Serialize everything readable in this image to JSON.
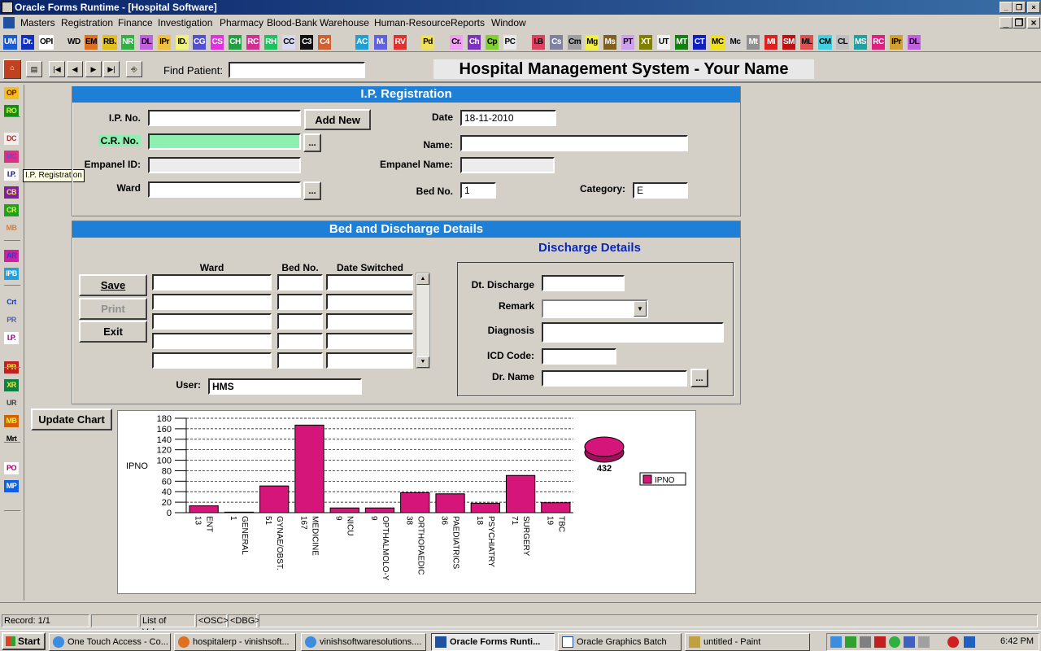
{
  "window": {
    "title": "Oracle Forms Runtime - [Hospital Software]"
  },
  "menu": [
    "Masters",
    "Registration",
    "Finance",
    "Investigation",
    "Pharmacy",
    "Blood-Bank",
    "Warehouse",
    "Human-Resource",
    "Reports",
    "Window"
  ],
  "toolbar_icons": [
    "UM",
    "Dr.",
    "OPI",
    "WD",
    "EM",
    "RB.",
    "NR",
    "DL",
    "IPr",
    "ID.",
    "CG",
    "CS",
    "CH",
    "RC",
    "RH",
    "CC",
    "C3",
    "C4",
    "AC",
    "M.",
    "RV",
    "Pd",
    "Cr.",
    "Ch",
    "Cp",
    "PC",
    "I.B",
    "Cs",
    "Cm",
    "Mg",
    "Ms",
    "PT",
    "XT",
    "UT",
    "MT",
    "CT",
    "MC",
    "Mc",
    "Mt",
    "MI",
    "SM",
    "ML",
    "CM",
    "CL",
    "MS",
    "RC",
    "IPr",
    "DL"
  ],
  "nav": {
    "find_patient_label": "Find Patient:",
    "find_patient_value": "",
    "header_title": "Hospital Management System - Your Name"
  },
  "sidebar": [
    "OP",
    "RO",
    "DC",
    "MC",
    "I.P.",
    "CB",
    "CR",
    "MB",
    "AR",
    "IPB",
    "Crt",
    "PR",
    "I.P.",
    "PR",
    "XR",
    "UR",
    "MB",
    "Mrt",
    "PO",
    "MP"
  ],
  "tooltip": "I.P. Registration",
  "ip_registration": {
    "title": "I.P. Registration",
    "ip_no_label": "I.P. No.",
    "ip_no": "",
    "add_new": "Add New",
    "date_label": "Date",
    "date": "18-11-2010",
    "cr_no_label": "C.R. No.",
    "cr_no": "",
    "lov_button": "...",
    "name_label": "Name:",
    "name": "",
    "empanel_id_label": "Empanel ID:",
    "empanel_id": "",
    "empanel_name_label": "Empanel Name:",
    "empanel_name": "",
    "ward_label": "Ward",
    "ward": "",
    "bed_no_label": "Bed No.",
    "bed_no": "1",
    "category_label": "Category:",
    "category": "E"
  },
  "bed_discharge": {
    "title": "Bed and Discharge Details",
    "col_ward": "Ward",
    "col_bed": "Bed No.",
    "col_date": "Date Switched",
    "save": "Save",
    "print": "Print",
    "exit": "Exit",
    "user_label": "User:",
    "user": "HMS"
  },
  "discharge": {
    "title": "Discharge Details",
    "dt_discharge_label": "Dt. Discharge",
    "dt_discharge": "",
    "remark_label": "Remark",
    "remark": "",
    "diagnosis_label": "Diagnosis",
    "diagnosis": "",
    "icd_label": "ICD Code:",
    "icd": "",
    "dr_name_label": "Dr. Name",
    "dr_name": ""
  },
  "update_chart": "Update Chart",
  "chart_data": {
    "type": "bar",
    "ylabel": "IPNO",
    "ylim": [
      0,
      180
    ],
    "yticks": [
      0,
      20,
      40,
      60,
      80,
      100,
      120,
      140,
      160,
      180
    ],
    "categories": [
      "ENT",
      "GENERAL",
      "GYNAE/OBST.",
      "MEDICINE",
      "NICU",
      "OPTHALMOLO-Y",
      "ORTHOPAEDIC",
      "PAEDIATRICS",
      "PSYCHIATRY",
      "SURGERY",
      "TBC"
    ],
    "values": [
      13,
      1,
      51,
      167,
      9,
      9,
      38,
      36,
      18,
      71,
      19
    ],
    "series": [
      {
        "name": "IPNO",
        "values": [
          13,
          1,
          51,
          167,
          9,
          9,
          38,
          36,
          18,
          71,
          19
        ]
      }
    ],
    "pie_total": "432",
    "color": "#d6157a",
    "grid": true,
    "legend": "right"
  },
  "status": {
    "record": "Record: 1/1",
    "lov": "List of Values",
    "osc": "<OSC>",
    "dbg": "<DBG>"
  },
  "taskbar": {
    "start": "Start",
    "items": [
      "One Touch Access - Co...",
      "hospitalerp - vinishsoft...",
      "vinishsoftwaresolutions....",
      "Oracle Forms Runti...",
      "Oracle Graphics Batch",
      "untitled - Paint"
    ],
    "clock": "6:42 PM"
  }
}
